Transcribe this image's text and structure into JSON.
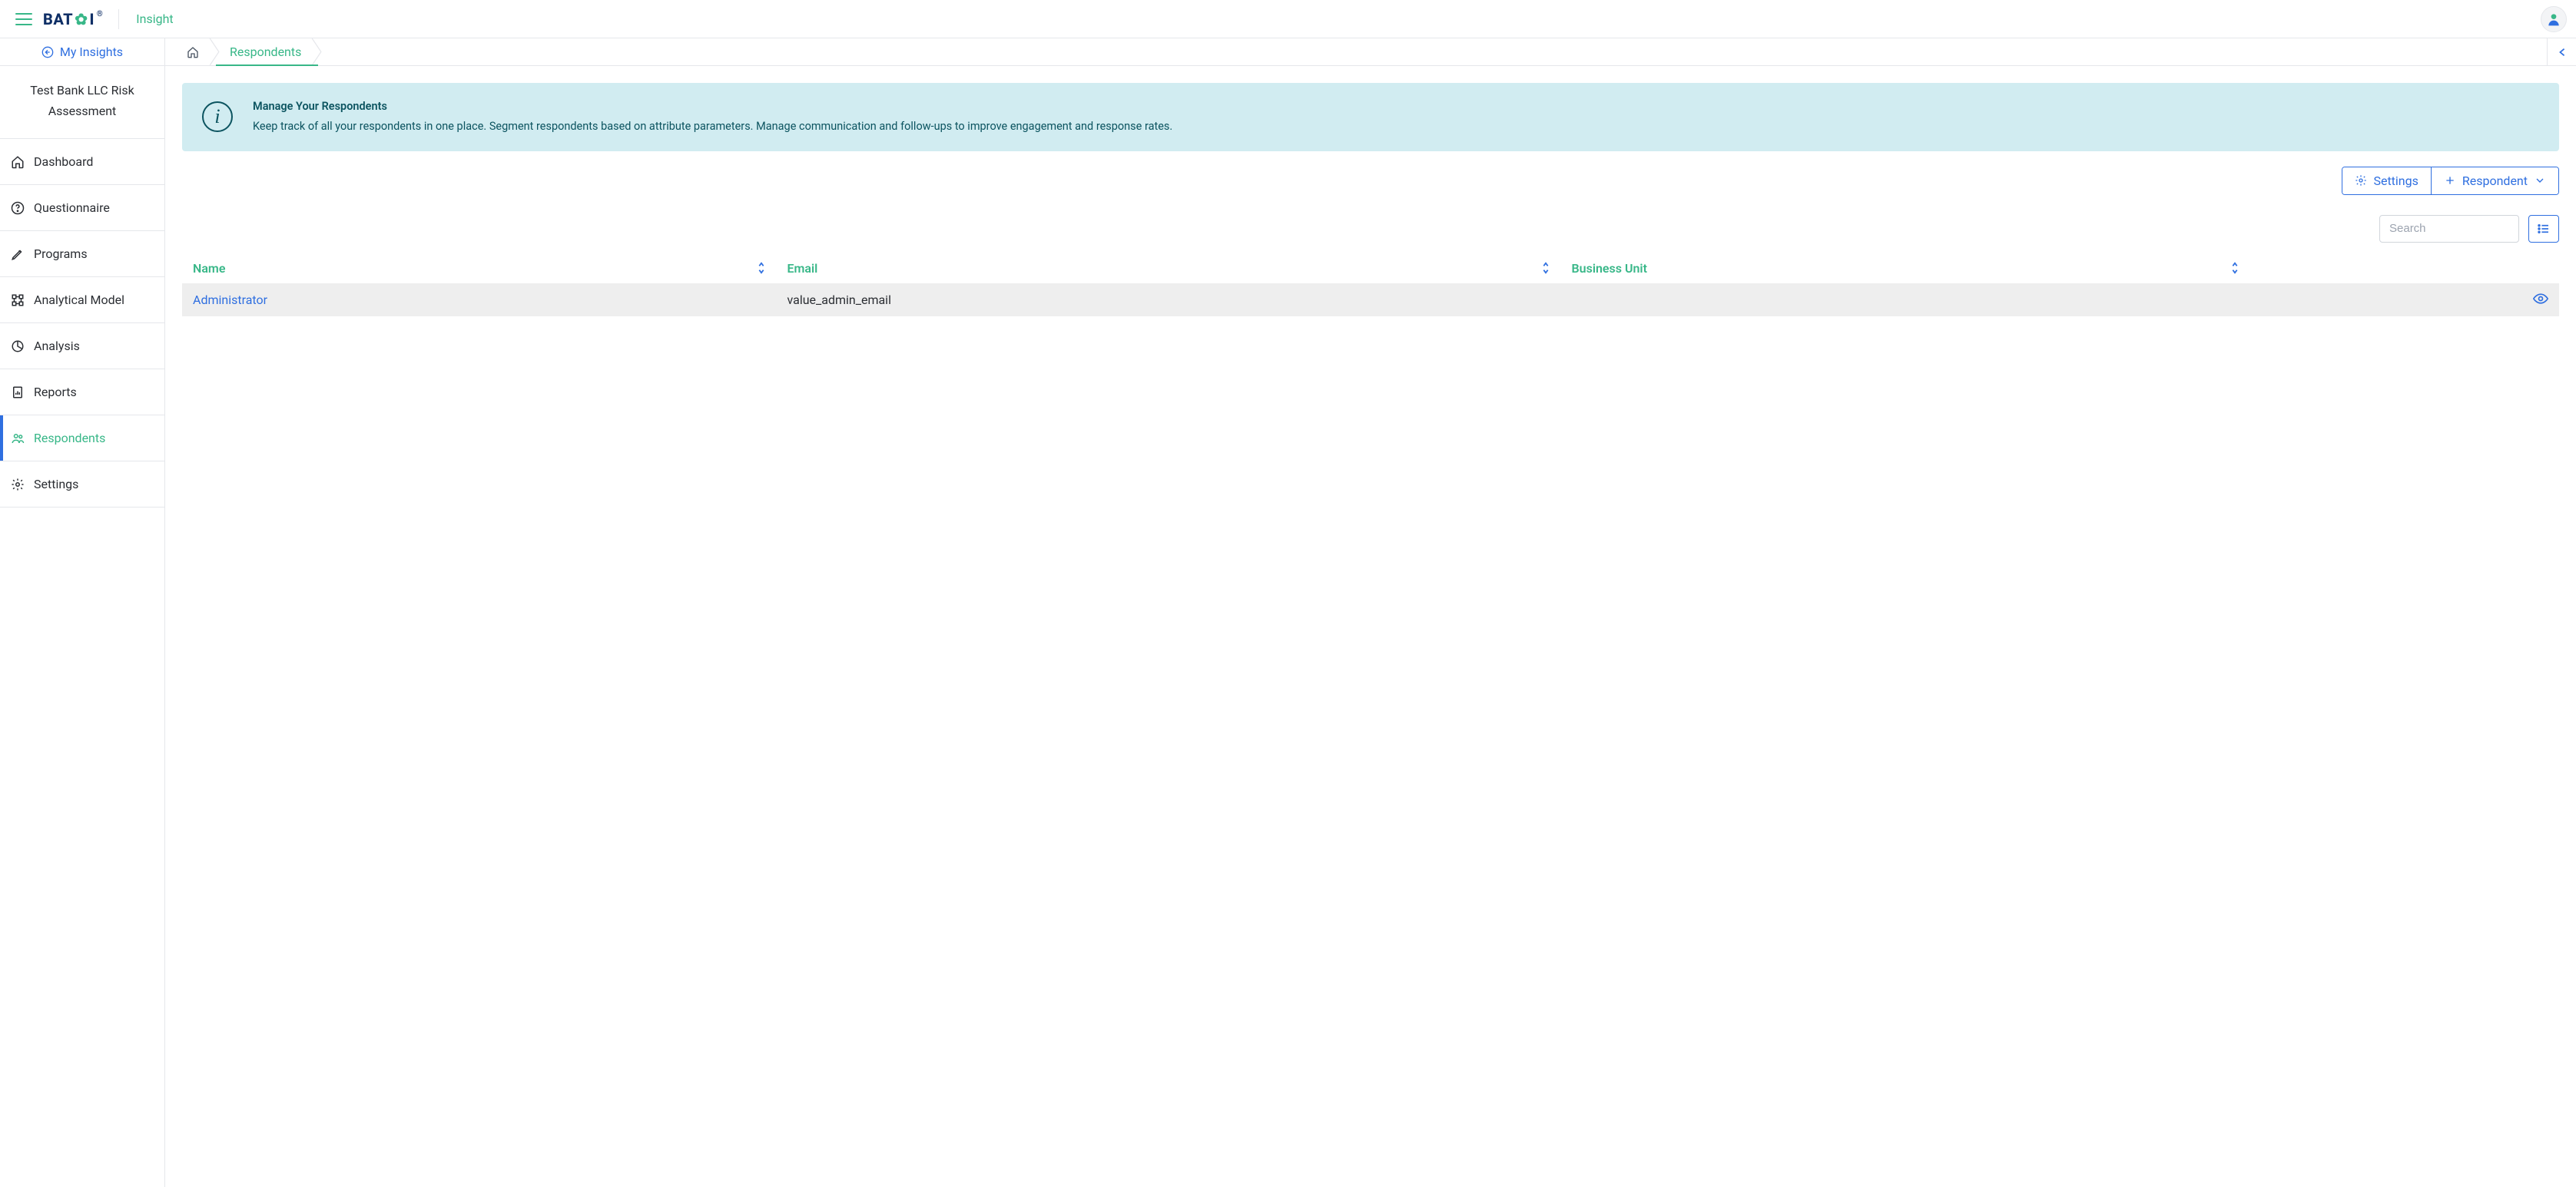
{
  "header": {
    "brand": "BAT",
    "brand_suffix": "I",
    "product": "Insight"
  },
  "sidebar": {
    "my_insights": "My Insights",
    "project_title": "Test Bank LLC Risk Assessment",
    "items": [
      {
        "label": "Dashboard"
      },
      {
        "label": "Questionnaire"
      },
      {
        "label": "Programs"
      },
      {
        "label": "Analytical Model"
      },
      {
        "label": "Analysis"
      },
      {
        "label": "Reports"
      },
      {
        "label": "Respondents"
      },
      {
        "label": "Settings"
      }
    ]
  },
  "breadcrumbs": {
    "current": "Respondents"
  },
  "banner": {
    "title": "Manage Your Respondents",
    "body": "Keep track of all your respondents in one place. Segment respondents based on attribute parameters. Manage communication and follow-ups to improve engagement and response rates."
  },
  "actions": {
    "settings": "Settings",
    "add_respondent": "Respondent"
  },
  "search": {
    "placeholder": "Search"
  },
  "table": {
    "headers": {
      "name": "Name",
      "email": "Email",
      "bu": "Business Unit"
    },
    "rows": [
      {
        "name": "Administrator",
        "email": "value_admin_email",
        "bu": ""
      }
    ]
  }
}
